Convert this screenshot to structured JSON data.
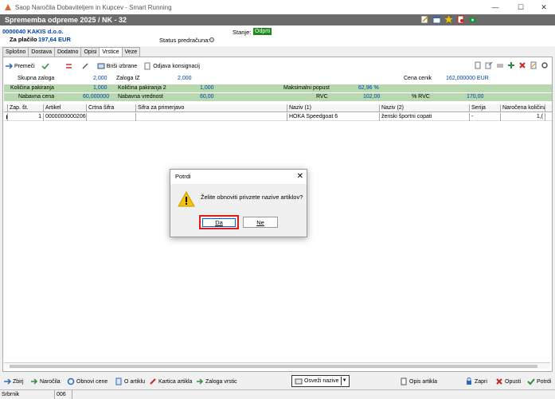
{
  "window": {
    "app_icon": "saop-logo-icon",
    "title": "Saop  Naročila Dobaviteljem in Kupcev - Smart Running",
    "controls": [
      "minimize-icon",
      "maximize-icon",
      "close-icon"
    ]
  },
  "header": {
    "title": "Sprememba odpreme 2025 / NK - 32",
    "icons": [
      "edit-icon",
      "calendar-icon",
      "star-icon",
      "document-icon",
      "money-icon"
    ]
  },
  "info": {
    "partner": "0000040 KAKIS d.o.o.",
    "za_placilo_label": "Za plačilo",
    "za_placilo_value": "197,64 EUR",
    "stanje_label": "Stanje:",
    "stanje_value": "Odprti",
    "status_label": "Status predračuna:"
  },
  "tabs": [
    "Splošno",
    "Dostava",
    "Dodatno",
    "Opisi",
    "Vrstice",
    "Veze"
  ],
  "active_tab": "Vrstice",
  "toolbar": {
    "premeci": "Premeči",
    "brisi_izbrane": "Briši izbrane",
    "odjava_konsignacij": "Odjava konsignacij",
    "right_icons": [
      "new-icon",
      "export-icon",
      "print-icon",
      "add-icon",
      "delete-icon",
      "edit-doc-icon",
      "settings-icon"
    ]
  },
  "summary": {
    "row1": {
      "skupna_zaloga_label": "Skupna zaloga",
      "skupna_zaloga_value": "2,000",
      "zaloga_iz_label": "Zaloga IZ",
      "zaloga_iz_value": "2,000",
      "cena_cenik_label": "Cena cenik",
      "cena_cenik_value": "162,000000 EUR"
    },
    "row2": {
      "kolicina_pakiranja_label": "Količina pakiranja",
      "kolicina_pakiranja_value": "1,000",
      "kolicina_pakiranja2_label": "Količina pakiranja 2",
      "kolicina_pakiranja2_value": "1,000",
      "maks_popust_label": "Maksimalni popust",
      "maks_popust_value": "62,96 %"
    },
    "row3": {
      "nabavna_cena_label": "Nabavna cena",
      "nabavna_cena_value": "60,000000",
      "nabavna_vrednost_label": "Nabavna vrednost",
      "nabavna_vrednost_value": "60,00",
      "rvc_label": "RVC",
      "rvc_value": "102,00",
      "pct_rvc_label": "% RVC",
      "pct_rvc_value": "170,00"
    }
  },
  "grid": {
    "columns": [
      "Zap. št.",
      "Artikel",
      "Črtna šifra",
      "Šifra za primerjavo",
      "Naziv (1)",
      "Naziv (2)",
      "Serija",
      "Naročena količina"
    ],
    "rows": [
      [
        "1",
        "0000000000206",
        "",
        "",
        "HOKA Speedgoat 6",
        "ženski športni copati",
        "-",
        "1,("
      ]
    ]
  },
  "bottom_buttons": {
    "zbirj": "Zbirj",
    "narocila": "Naročila",
    "obnovi_cene": "Obnovi cene",
    "o_artiklu": "O artiklu",
    "kartica_artikla": "Kartica artikla",
    "zaloga_vrstic": "Zaloga vrstic",
    "osvezi_nazive": "Osveži nazive",
    "opis_artikla": "Opis artikla",
    "zapri": "Zapri",
    "opusti": "Opusti",
    "potrdi": "Potrdi"
  },
  "statusbar": {
    "user": "Srbrnik",
    "code": "006"
  },
  "dialog": {
    "title": "Potrdi",
    "message": "Želite obnoviti privzete nazive artiklov?",
    "yes": "Da",
    "no": "Ne"
  },
  "colors": {
    "header_bg": "#6b6b6b",
    "summary_green": "#b8d9b0",
    "status_green": "#1e8a1e",
    "highlight_red": "#e01b1b",
    "value_blue": "#0044aa"
  }
}
